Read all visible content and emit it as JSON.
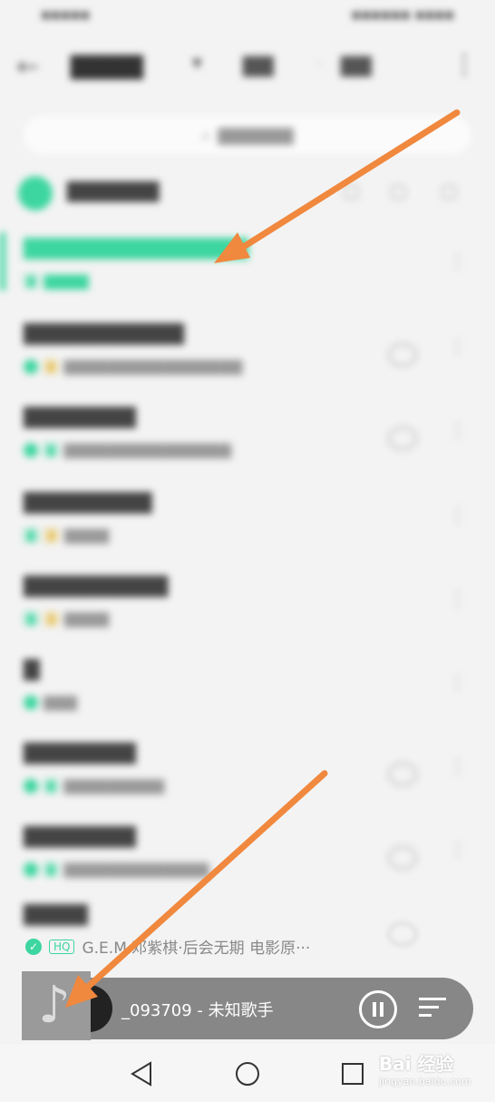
{
  "player": {
    "now_playing": "_093709 - 未知歌手"
  },
  "last_song": {
    "quality_badge": "HQ",
    "subtitle": "G.E.M.邓紫棋·后会无期 电影原···"
  },
  "watermark": {
    "text": "Bai 经验",
    "sub": "jingyan.baidu.com"
  },
  "colors": {
    "accent": "#3dd6a0",
    "arrow": "#f0883e",
    "player_bg": "#878787"
  },
  "icons": {
    "nav_back": "triangle-back-icon",
    "nav_home": "circle-home-icon",
    "nav_recent": "square-recent-icon"
  }
}
